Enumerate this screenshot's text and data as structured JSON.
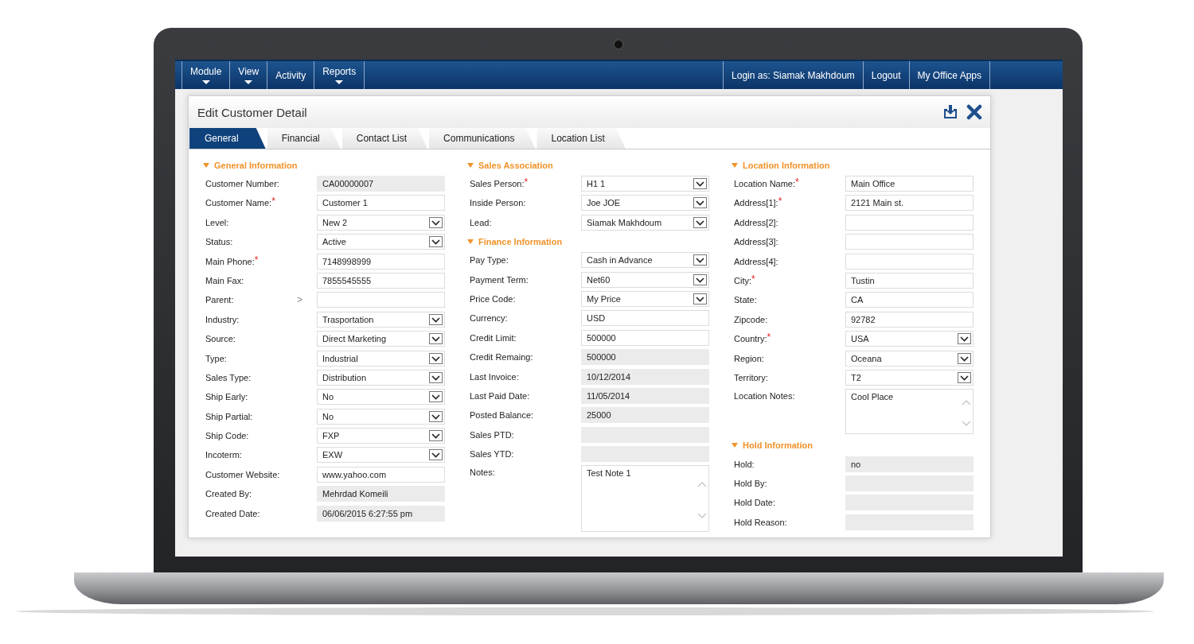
{
  "nav": {
    "left": [
      {
        "label": "Module",
        "has_menu": true
      },
      {
        "label": "View",
        "has_menu": true
      },
      {
        "label": "Activity",
        "has_menu": false
      },
      {
        "label": "Reports",
        "has_menu": true
      }
    ],
    "right": [
      "Login as: Siamak Makhdoum",
      "Logout",
      "My Office Apps"
    ]
  },
  "dialog": {
    "title": "Edit Customer Detail",
    "tabs": [
      {
        "label": "General",
        "selected": true
      },
      {
        "label": "Financial",
        "selected": false
      },
      {
        "label": "Contact List",
        "selected": false
      },
      {
        "label": "Communications",
        "selected": false
      },
      {
        "label": "Location List",
        "selected": false
      }
    ],
    "columns": [
      [
        {
          "title": "General Information",
          "expanded": true,
          "fields": [
            {
              "label": "Customer Number:",
              "kind": "readonly",
              "value": "CA00000007"
            },
            {
              "label": "Customer Name:",
              "required_mark": "*",
              "kind": "text",
              "value": "Customer 1"
            },
            {
              "label": "Level:",
              "kind": "select",
              "value": "New 2"
            },
            {
              "label": "Status:",
              "kind": "select",
              "value": "Active"
            },
            {
              "label": "Main Phone:",
              "required_mark": "*",
              "kind": "text",
              "value": "7148998999"
            },
            {
              "label": "Main Fax:",
              "kind": "text",
              "value": "7855545555"
            },
            {
              "label": "Parent:",
              "kind": "lookup",
              "lookup_mark": ">"
            },
            {
              "label": "Industry:",
              "kind": "select",
              "value": "Trasportation"
            },
            {
              "label": "Source:",
              "kind": "select",
              "value": "Direct Marketing"
            },
            {
              "label": "Type:",
              "kind": "select",
              "value": "Industrial"
            },
            {
              "label": "Sales Type:",
              "kind": "select",
              "value": "Distribution"
            },
            {
              "label": "Ship Early:",
              "kind": "select",
              "value": "No"
            },
            {
              "label": "Ship Partial:",
              "kind": "select",
              "value": "No"
            },
            {
              "label": "Ship Code:",
              "kind": "select",
              "value": "FXP"
            },
            {
              "label": "Incoterm:",
              "kind": "select",
              "value": "EXW"
            },
            {
              "label": "Customer Website:",
              "kind": "text",
              "value": "www.yahoo.com"
            },
            {
              "label": "Created By:",
              "kind": "readonly",
              "value": "Mehrdad Komeili"
            },
            {
              "label": "Created Date:",
              "kind": "readonly",
              "value": "06/06/2015  6:27:55 pm"
            }
          ]
        }
      ],
      [
        {
          "title": "Sales Association",
          "expanded": true,
          "fields": [
            {
              "label": "Sales Person:",
              "required_mark": "*",
              "kind": "select",
              "value": "H1 1"
            },
            {
              "label": "Inside Person:",
              "kind": "select",
              "value": "Joe JOE"
            },
            {
              "label": "Lead:",
              "kind": "select",
              "value": "Siamak Makhdoum"
            }
          ]
        },
        {
          "title": "Finance Information",
          "expanded": true,
          "fields": [
            {
              "label": "Pay Type:",
              "kind": "select",
              "value": "Cash in Advance"
            },
            {
              "label": "Payment Term:",
              "kind": "select",
              "value": "Net60"
            },
            {
              "label": "Price Code:",
              "kind": "select",
              "value": "My Price"
            },
            {
              "label": "Currency:",
              "kind": "text",
              "value": "USD"
            },
            {
              "label": "Credit Limit:",
              "kind": "text",
              "value": "500000"
            },
            {
              "label": "Credit Remaing:",
              "kind": "readonly",
              "value": "500000"
            },
            {
              "label": "Last Invoice:",
              "kind": "readonly",
              "value": "10/12/2014"
            },
            {
              "label": "Last Paid Date:",
              "kind": "readonly",
              "value": "11/05/2014"
            },
            {
              "label": "Posted Balance:",
              "kind": "readonly",
              "value": "25000"
            },
            {
              "label": "Sales PTD:",
              "kind": "readonly"
            },
            {
              "label": "Sales YTD:",
              "kind": "readonly"
            },
            {
              "label": "Notes:",
              "kind": "textarea",
              "value": "Test Note 1"
            }
          ]
        }
      ],
      [
        {
          "title": "Location Information",
          "expanded": true,
          "fields": [
            {
              "label": "Location Name:",
              "required_mark": "*",
              "kind": "text",
              "value": "Main Office"
            },
            {
              "label": "Address[1]:",
              "required_mark": "*",
              "kind": "text",
              "value": "2121 Main st."
            },
            {
              "label": "Address[2]:",
              "kind": "text"
            },
            {
              "label": "Address[3]:",
              "kind": "text"
            },
            {
              "label": "Address[4]:",
              "kind": "text"
            },
            {
              "label": "City:",
              "required_mark": "*",
              "kind": "text",
              "value": "Tustin"
            },
            {
              "label": "State:",
              "kind": "text",
              "value": "CA"
            },
            {
              "label": "Zipcode:",
              "kind": "text",
              "value": "92782"
            },
            {
              "label": "Country:",
              "required_mark": "*",
              "kind": "select",
              "value": "USA"
            },
            {
              "label": "Region:",
              "kind": "select",
              "value": "Oceana"
            },
            {
              "label": "Territory:",
              "kind": "select",
              "value": "T2"
            },
            {
              "label": "Location Notes:",
              "kind": "textarea",
              "value": "Cool Place"
            }
          ]
        },
        {
          "title": "Hold Information",
          "expanded": true,
          "fields": [
            {
              "label": "Hold:",
              "kind": "readonly",
              "value": "no"
            },
            {
              "label": "Hold By:",
              "kind": "readonly"
            },
            {
              "label": "Hold Date:",
              "kind": "readonly"
            },
            {
              "label": "Hold Reason:",
              "kind": "readonly"
            }
          ]
        }
      ]
    ]
  }
}
